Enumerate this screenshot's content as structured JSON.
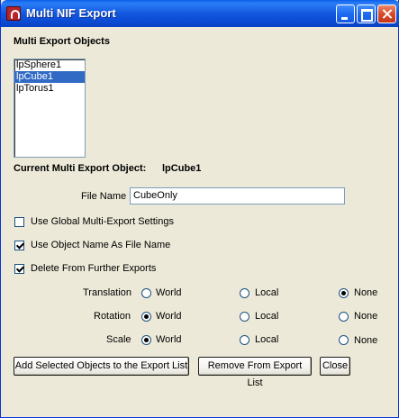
{
  "window": {
    "title": "Multi NIF Export"
  },
  "objects_section": {
    "heading": "Multi Export Objects",
    "items": [
      {
        "label": "lpSphere1",
        "selected": false
      },
      {
        "label": "lpCube1",
        "selected": true
      },
      {
        "label": "lpTorus1",
        "selected": false
      }
    ]
  },
  "current": {
    "label": "Current Multi Export Object:",
    "value": "lpCube1"
  },
  "file_name": {
    "label": "File Name",
    "value": "CubeOnly"
  },
  "options": [
    {
      "label": "Use Global Multi-Export Settings",
      "checked": false
    },
    {
      "label": "Use Object Name As File Name",
      "checked": true
    },
    {
      "label": "Delete From Further Exports",
      "checked": true
    }
  ],
  "transform_rows": [
    {
      "label": "Translation",
      "selected": "None"
    },
    {
      "label": "Rotation",
      "selected": "World"
    },
    {
      "label": "Scale",
      "selected": "World"
    }
  ],
  "transform_choices": [
    "World",
    "Local",
    "None"
  ],
  "buttons": {
    "add": "Add Selected Objects to the Export List",
    "remove": "Remove From Export List",
    "close": "Close"
  },
  "colors": {
    "title_bar": "#0a48d1",
    "selection": "#316ac5",
    "window_bg": "#ece9d8"
  }
}
